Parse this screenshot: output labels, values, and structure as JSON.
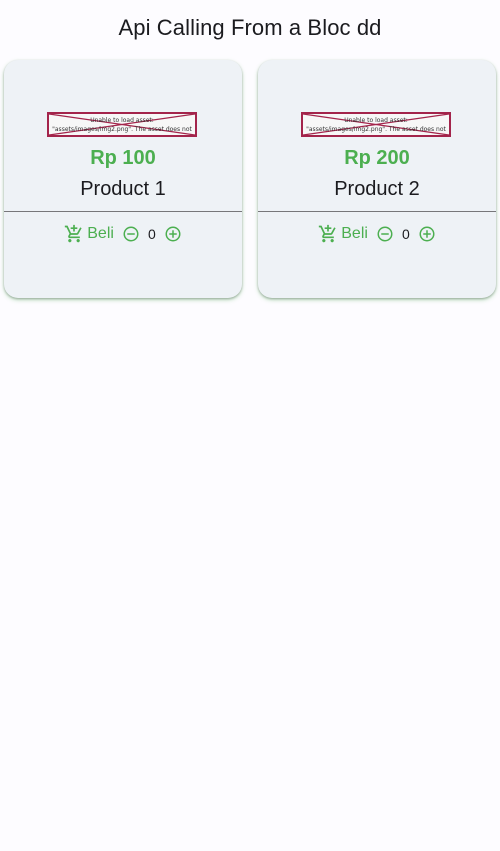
{
  "appbar": {
    "title": "Api Calling From a Bloc dd"
  },
  "colors": {
    "accent": "#4caf50",
    "error_border": "#a3244b",
    "card_bg": "#eef2f6"
  },
  "products": [
    {
      "image_error": "Unable to load asset: \"assets/images/img2.png\". The asset does not exist or has empty data.",
      "price": "Rp 100",
      "name": "Product 1",
      "buy_label": "Beli",
      "quantity": "0"
    },
    {
      "image_error": "Unable to load asset: \"assets/images/img2.png\". The asset does not exist or has empty data.",
      "price": "Rp 200",
      "name": "Product 2",
      "buy_label": "Beli",
      "quantity": "0"
    }
  ],
  "icons": {
    "cart": "add-shopping-cart-icon",
    "minus": "remove-circle-outline-icon",
    "plus": "add-circle-outline-icon"
  }
}
